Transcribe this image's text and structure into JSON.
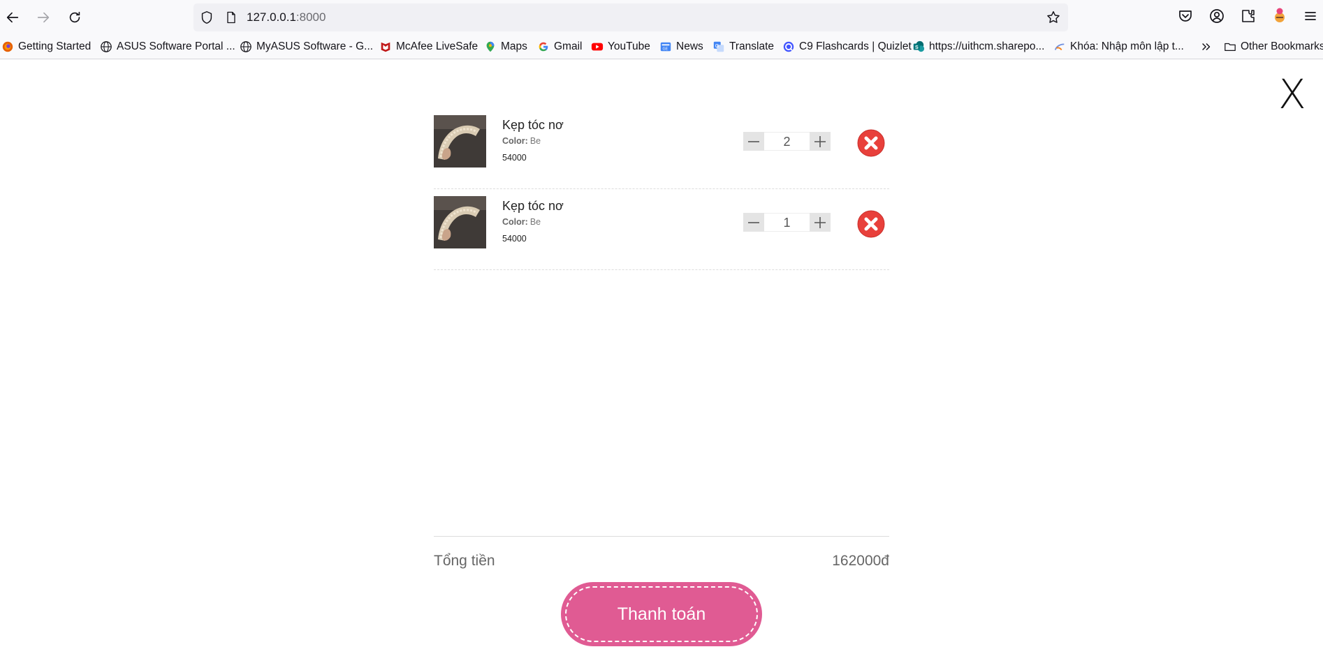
{
  "browser": {
    "url_host": "127.0.0.1",
    "url_port": ":8000",
    "toolbar_icons": [
      "back-arrow-icon",
      "forward-arrow-icon",
      "reload-icon",
      "shield-icon",
      "page-icon",
      "bookmark-star-icon",
      "pocket-icon",
      "account-icon",
      "extensions-icon",
      "profile-avatar-icon",
      "menu-icon"
    ],
    "bookmarks": [
      {
        "label": "Getting Started",
        "icon": "firefox-icon"
      },
      {
        "label": "ASUS Software Portal ...",
        "icon": "globe-icon"
      },
      {
        "label": "MyASUS Software - G...",
        "icon": "globe-icon"
      },
      {
        "label": "McAfee LiveSafe",
        "icon": "mcafee-icon"
      },
      {
        "label": "Maps",
        "icon": "maps-pin-icon"
      },
      {
        "label": "Gmail",
        "icon": "google-icon"
      },
      {
        "label": "YouTube",
        "icon": "youtube-icon"
      },
      {
        "label": "News",
        "icon": "news-icon"
      },
      {
        "label": "Translate",
        "icon": "translate-icon"
      },
      {
        "label": "C9 Flashcards | Quizlet",
        "icon": "quizlet-icon"
      },
      {
        "label": "https://uithcm.sharepo...",
        "icon": "sharepoint-icon"
      },
      {
        "label": "Khóa: Nhập môn lập t...",
        "icon": "moodle-icon"
      }
    ],
    "overflow_icon": "chevron-double-right-icon",
    "other_bookmarks": "Other Bookmarks"
  },
  "cart": {
    "close_label": "X",
    "color_label": "Color:",
    "items": [
      {
        "name": "Kẹp tóc nơ",
        "color": "Be",
        "price": "54000",
        "quantity": "2"
      },
      {
        "name": "Kẹp tóc nơ",
        "color": "Be",
        "price": "54000",
        "quantity": "1"
      }
    ],
    "total_label": "Tổng tiền",
    "total_value": "162000đ",
    "checkout_label": "Thanh toán"
  },
  "colors": {
    "checkout_button": "#e05b93",
    "remove_button": "#e8403b",
    "stepper_bg": "#e4e4e4"
  }
}
